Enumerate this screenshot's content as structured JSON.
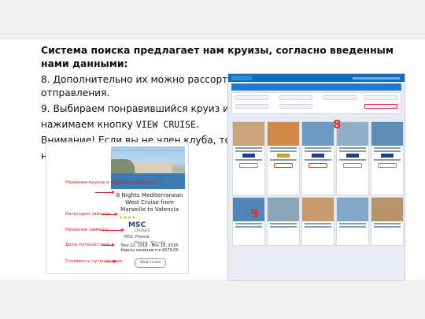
{
  "slide": {
    "title": "Система поиска предлагает нам круизы, согласно введенным нами данными:",
    "line8": "8. Дополнительно их можно рассортировать по стоимости и дате отправления.",
    "line9a": "9. Выбираем понравившийся круиз и",
    "line9b_prefix": "нажимаем кнопку ",
    "line9b_keyword": "VIEW CRUISE",
    "line9b_suffix": ".",
    "line10a": "Внимание! Если вы не член клуба, то у вас",
    "line10b": "не буд"
  },
  "site_screenshot": {
    "marker_8": "8",
    "marker_9": "9"
  },
  "cruise_card": {
    "title": "8 Nights Mediterranean West Cruise from Marseille to Valencia",
    "stars": "★★★★☆",
    "brand": "MSC",
    "brand_sub": "CRUISES",
    "ship": "MSC Poesia",
    "port": "Марсель, Франция",
    "dates": "Nov 12, 2018 - Nov 18, 2018",
    "price": "Каюты начинаются $579.00",
    "button": "View Cruise"
  },
  "annotations": [
    "Название круиза и продолжительность",
    "Категория лайнера",
    "Название лайнера",
    "Даты путешествия",
    "Стоимость путешествия"
  ],
  "colors": {
    "annotation": "#d11d1d",
    "site_header": "#0a6fc2",
    "band": "#f1f1f1"
  }
}
